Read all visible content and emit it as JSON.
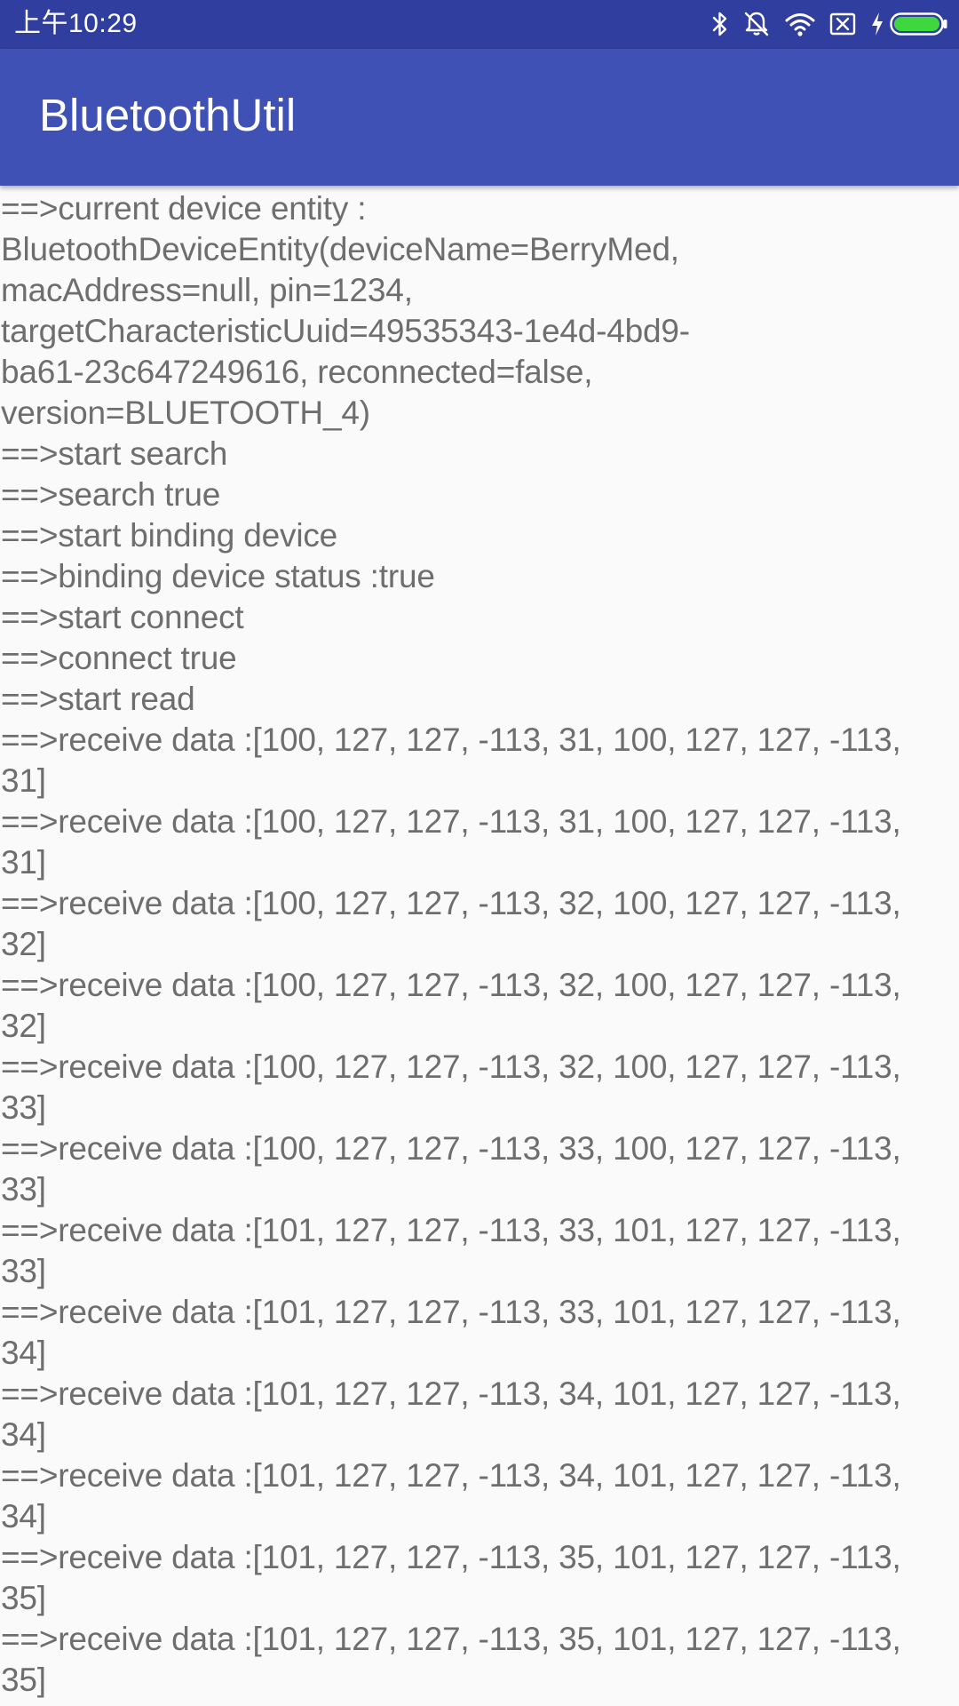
{
  "status_bar": {
    "time": "上午10:29",
    "icons": [
      "bluetooth-icon",
      "mute-icon",
      "wifi-icon",
      "no-sim-icon",
      "charging-icon",
      "battery-icon"
    ],
    "battery_level": 1.0,
    "battery_color": "#3ed83e"
  },
  "app_bar": {
    "title": "BluetoothUtil",
    "color": "#3f51b5",
    "status_color": "#303f9f"
  },
  "log": {
    "lines": [
      "==>current device entity :\nBluetoothDeviceEntity(deviceName=BerryMed,\nmacAddress=null, pin=1234,\ntargetCharacteristicUuid=49535343-1e4d-4bd9-\nba61-23c647249616, reconnected=false,\nversion=BLUETOOTH_4)",
      "==>start search",
      "==>search true",
      "==>start binding device",
      "==>binding device status :true",
      "==>start connect",
      "==>connect true",
      "==>start read",
      "==>receive data :[100, 127, 127, -113, 31, 100, 127, 127, -113,\n31]",
      "==>receive data :[100, 127, 127, -113, 31, 100, 127, 127, -113,\n31]",
      "==>receive data :[100, 127, 127, -113, 32, 100, 127, 127, -113,\n32]",
      "==>receive data :[100, 127, 127, -113, 32, 100, 127, 127, -113,\n32]",
      "==>receive data :[100, 127, 127, -113, 32, 100, 127, 127, -113,\n33]",
      "==>receive data :[100, 127, 127, -113, 33, 100, 127, 127, -113,\n33]",
      "==>receive data :[101, 127, 127, -113, 33, 101, 127, 127, -113,\n33]",
      "==>receive data :[101, 127, 127, -113, 33, 101, 127, 127, -113,\n34]",
      "==>receive data :[101, 127, 127, -113, 34, 101, 127, 127, -113,\n34]",
      "==>receive data :[101, 127, 127, -113, 34, 101, 127, 127, -113,\n34]",
      "==>receive data :[101, 127, 127, -113, 35, 101, 127, 127, -113,\n35]",
      "==>receive data :[101, 127, 127, -113, 35, 101, 127, 127, -113,\n35]"
    ]
  }
}
